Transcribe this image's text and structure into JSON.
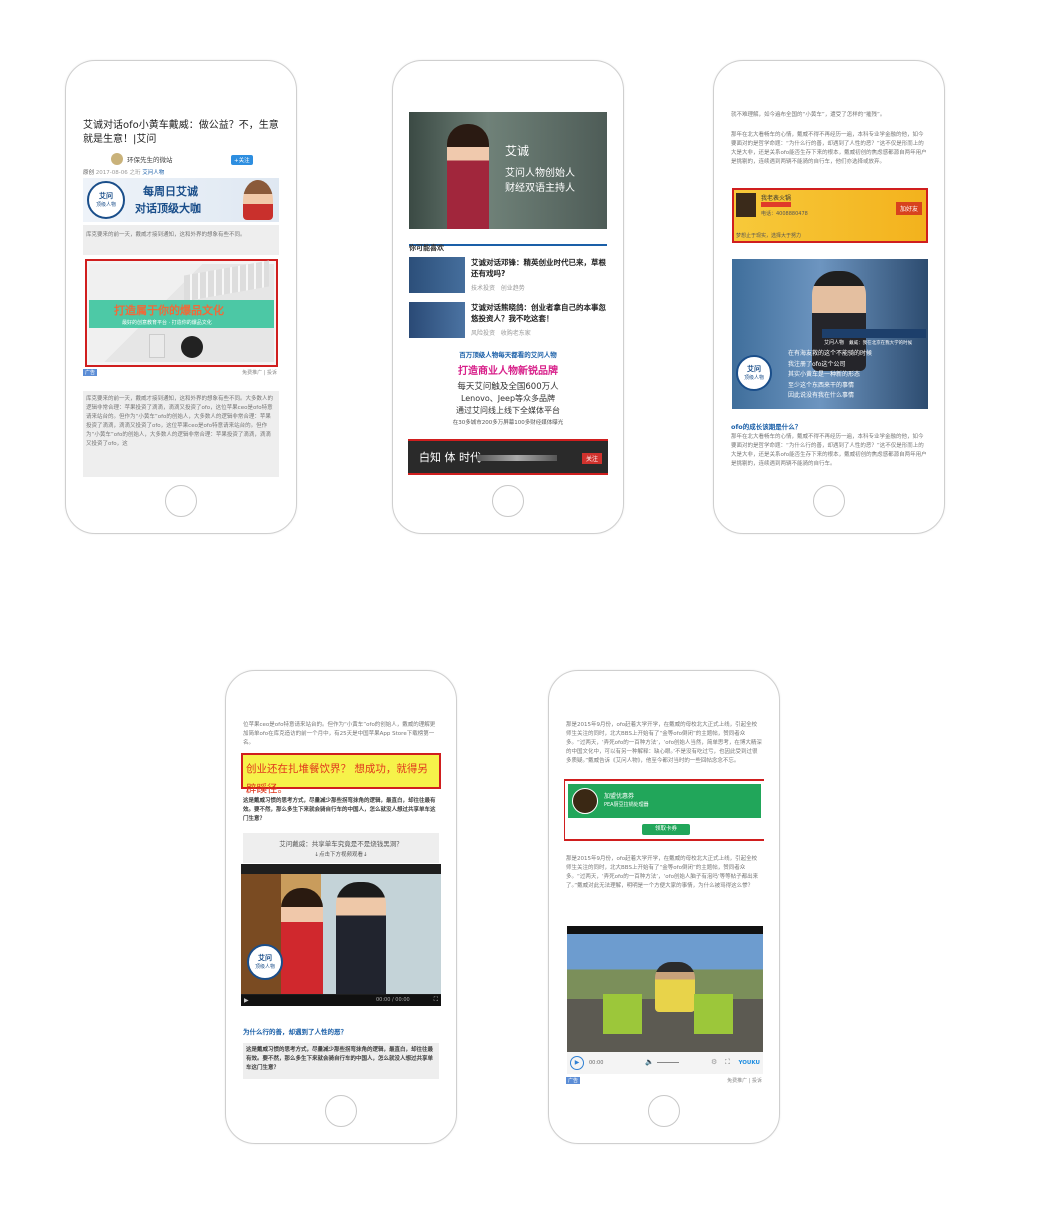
{
  "phone1": {
    "title": "艾诚对话ofo小黄车戴威：做公益？不，生意就是生意！|艾问",
    "account": "环保先生的微站",
    "follow": "+关注",
    "meta_original": "原创",
    "meta_date": "2017-08-06 之珩",
    "meta_source": "艾问人物",
    "banner_logo_1": "艾问",
    "banner_logo_2": "顶级人物",
    "banner_line1": "每周日艾诚",
    "banner_line2": "对话顶级大咖",
    "intro_text": "库克要来的前一天，戴威才接到通知，这和外界的想象有些不同。",
    "ad_headline": "打造属于你的爆品文化",
    "ad_subline": "最好的创意教育平台 · 打造你的爆品文化",
    "ad_tag": "广告",
    "ad_footer": "免费推广 | 投诉",
    "body_text": "库克要来的前一天，戴威才接到通知，这和外界的想象有些不同。大多数人的逻辑非常合理：苹果投资了滴滴，滴滴又投资了ofo，这位苹果ceo是ofo特意请来站台的。但作为“小黄车”ofo的创始人，大多数人的逻辑非常合理：苹果投资了滴滴，滴滴又投资了ofo，这位苹果ceo是ofo特意请来站台的。但作为“小黄车”ofo的创始人，大多数人的逻辑非常合理：苹果投资了滴滴，滴滴又投资了ofo，这"
  },
  "phone2": {
    "hero_name": "艾诚",
    "hero_line1": "艾问人物创始人",
    "hero_line2": "财经双语主持人",
    "section_title": "你可能喜欢",
    "items": [
      {
        "title": "艾诚对话邓锋：精英创业时代已来，草根还有戏吗?",
        "tag1": "技术投资",
        "tag2": "创业趋势"
      },
      {
        "title": "艾诚对话熊晓鸽：创业者拿自己的本事忽悠投资人？我不吃这套！",
        "tag1": "风险投资",
        "tag2": "收购老东家"
      }
    ],
    "promo_line1": "百万顶级人物每天都看的艾问人物",
    "promo_line2": "打造商业人物新锐品牌",
    "promo_line3": "每天艾问触及全国600万人",
    "promo_line4": "Lenovo、Jeep等众多品牌",
    "promo_line5": "通过艾问线上线下全媒体平台",
    "promo_line6": "在30多城市200多万屏幕100多财经媒体曝光",
    "ad_brand": "白知 体 时代",
    "ad_button": "关注"
  },
  "phone3": {
    "text_top1": "就不难理解，如今遍布全国的“小黄车”，遭受了怎样的“摧残”。",
    "text_top2": "那年在北大看畅车的心情，戴威不得不再经历一遍，本科专业学金融的他，如今要面对的是哲学命题：“为什么行的善，却遇到了人性的恶？”这不仅是形而上的大是大非，还是关系ofo能否生存下来的根本，戴威初创的焦虑感都源自两年用户是挑剔的，连续遇到两辆不能骑的自行车，他们亦选择或放弃。",
    "ad_name": "我老表火锅",
    "ad_phone": "电话：4008880478",
    "ad_button": "加好友",
    "ad_slogan": "梦想止于现实，选择大于努力",
    "video_logo": "艾问人物",
    "video_caption": "戴威：我在北京在我大学的时候",
    "subtitles": [
      "在有海友救的这个不能骑的时候",
      "我注册了ofo这个公司",
      "其实小黄车是一种新的形态",
      "至少这个东西来干的事情",
      "因此说没有我在什么事情"
    ],
    "video_badge_1": "艾问",
    "video_badge_2": "顶级人物",
    "heading": "ofo的成长该期是什么？",
    "text_bottom": "那年在北大看畅车的心情，戴威不得不再经历一遍，本科专业学金融的他，如今要面对的是哲学命题：“为什么行的善，却遇到了人性的恶？”这不仅是形而上的大是大非，还是关系ofo能否生存下来的根本，戴威初创的焦虑感都源自两年用户是挑剔的，连续遇到两辆不能骑的自行车。"
  },
  "phone4": {
    "text_top": "位苹果ceo是ofo特意请来站台的。但作为“小黄车”ofo的创始人，戴威的理解更加简单ofo在库克造访的前一个月中，有25天是中国苹果App Store下载榜第一名。",
    "highlight": "创业还在扎堆餐饮界？ 想成功，就得另辟蹊径。",
    "quote_text": "这是戴威习惯的思考方式，尽量减少那些拐弯抹角的逻辑，最直白，却往往最有效。要不然，那么多生下来就会骑自行车的中国人，怎么就没人想过共享单车这门生意？",
    "video_title": "艾问戴威：共享单车究竟是不是烧钱黑洞？",
    "video_hint": "↓点击下方视频观看↓",
    "badge_1": "艾问",
    "badge_2": "顶级人物",
    "time": "00:00 / 00:00",
    "heading": "为什么行的善，却遇到了人性的恶？",
    "bottom_text": "这是戴威习惯的思考方式，尽量减少那些拐弯抹角的逻辑，最直白，却往往最有效。要不然，那么多生下来就会骑自行车的中国人，怎么就没人想过共享单车这门生意？"
  },
  "phone5": {
    "text_top": "那是2015年9月份，ofo赶着大学开学，在戴威的母校北大正式上线，引起全校师生关注的同时，北大BBS上开始有了“金等ofo倒闭”的主题帖，赞同者众多。“过两天，‘弄死ofo的一百种方法’，‘ofo创始人当然，简单思考，在博大精深的中国文化中，可以有另一种解释：缺心眼。’不是没有吃过亏，也因此受到过很多质疑。”戴威告诉《艾问人物》，他至今都对当时的一些回帖念念不忘。",
    "coupon_title": "加盟优惠券",
    "coupon_sub": "PEA厨豆拉锅处理器",
    "coupon_button": "领取卡券",
    "text_mid": "那是2015年9月份，ofo赶着大学开学，在戴威的母校北大正式上线，引起全校师生关注的同时，北大BBS上开始有了“金等ofo倒闭”的主题帖，赞同者众多。“过两天，‘弄死ofo的一百种方法’，‘ofo创始人脑子有泡吗’等等帖子都出来了。”戴威对此无法理解，明明是一个方便大家的事情，为什么被骂得这么惨？",
    "time": "00:00",
    "player_logo": "YOUKU",
    "ad_tag": "广告",
    "ad_footer": "免费推广 | 投诉"
  },
  "colors": {
    "red_frame": "#d01e1e",
    "accent_blue": "#1a5fa8",
    "coupon_green": "#21a65a",
    "highlight_yellow": "#f6f24a"
  }
}
